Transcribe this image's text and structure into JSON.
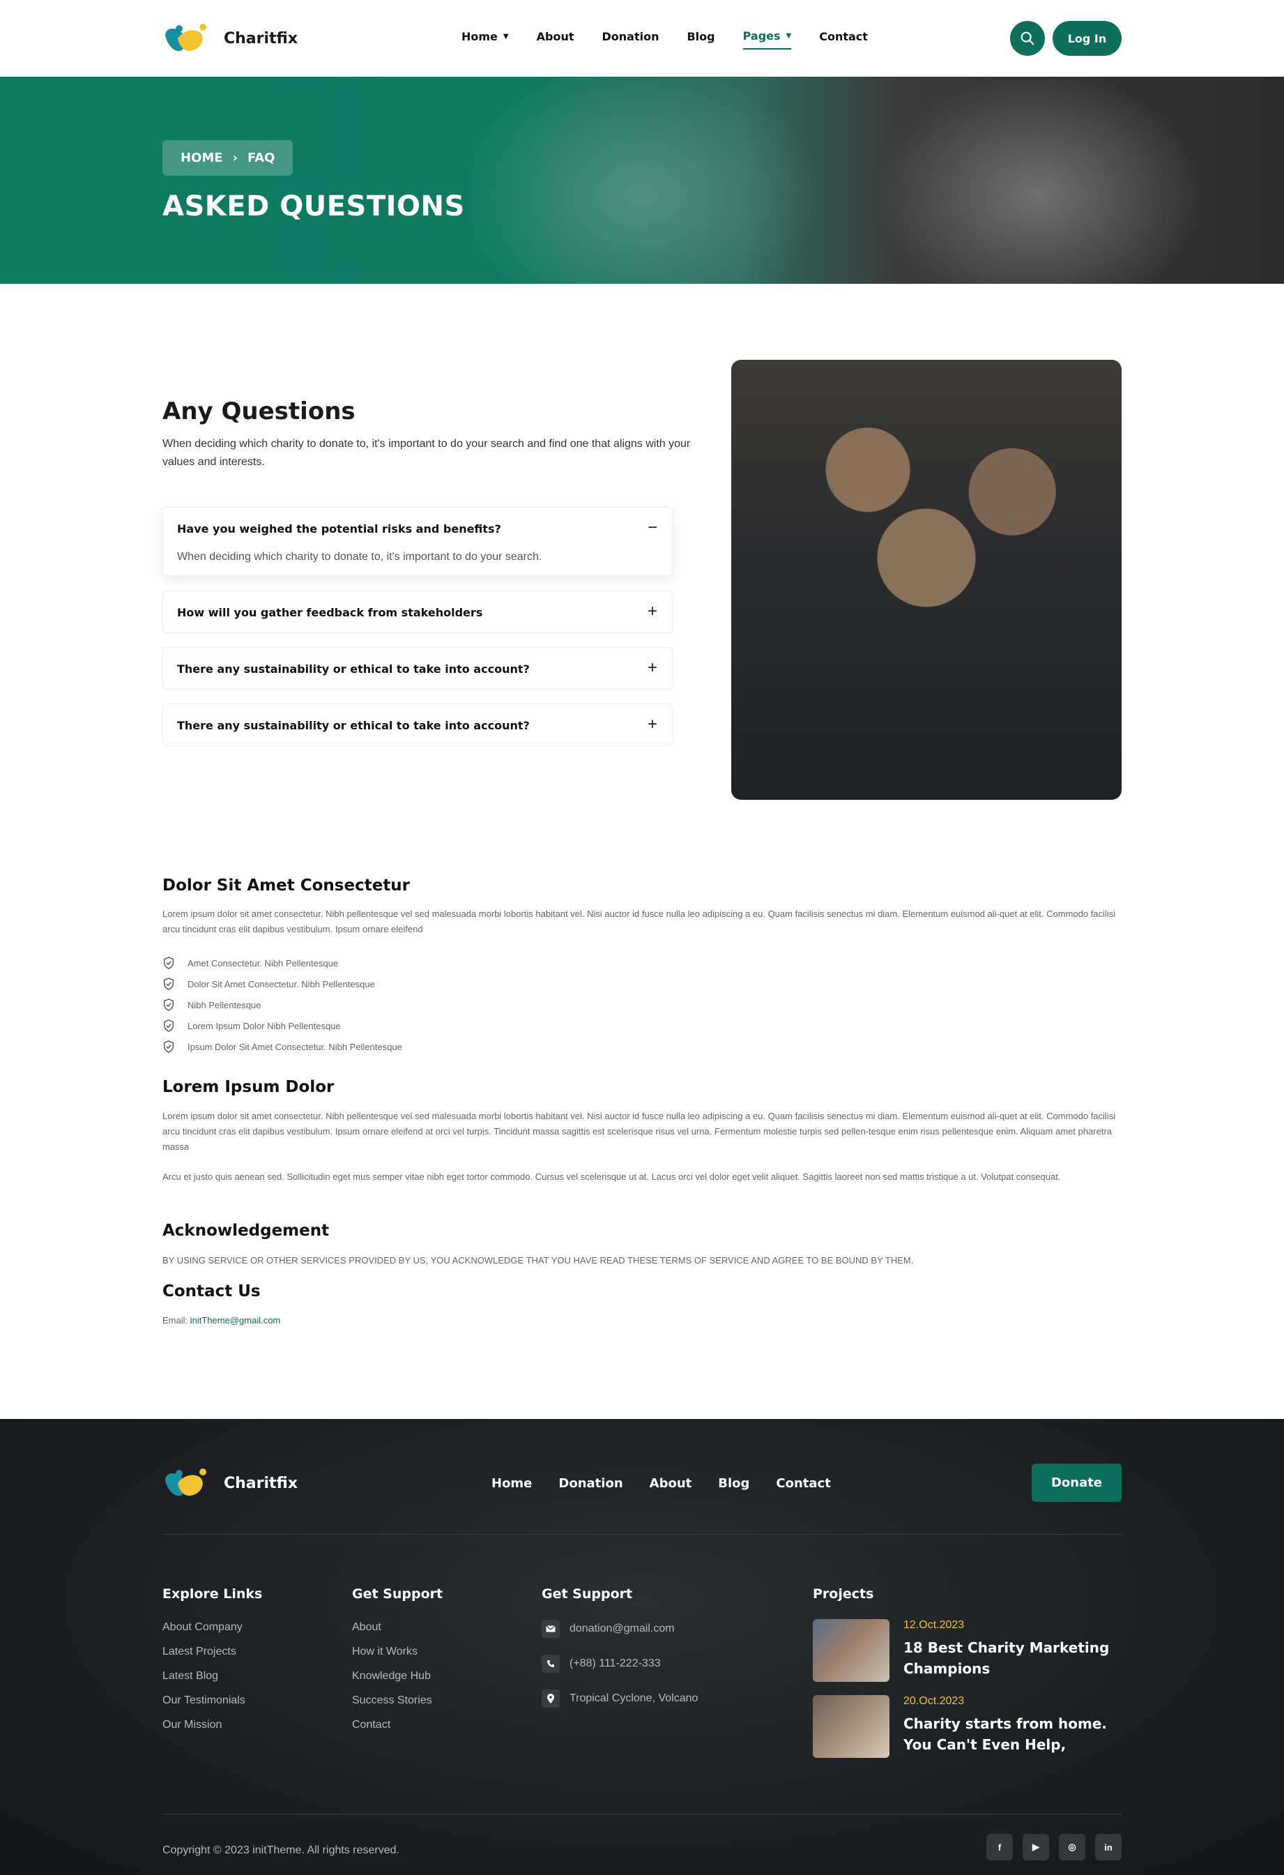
{
  "brand": {
    "name": "Charitfix",
    "accent": "#0d6e5b",
    "logo_teal": "#1a8fa3",
    "logo_yellow": "#f2c230"
  },
  "nav": {
    "items": [
      {
        "label": "Home",
        "dropdown": true
      },
      {
        "label": "About"
      },
      {
        "label": "Donation"
      },
      {
        "label": "Blog"
      },
      {
        "label": "Pages",
        "dropdown": true,
        "active": true
      },
      {
        "label": "Contact"
      }
    ],
    "search_icon": "search-icon",
    "login_label": "Log In"
  },
  "hero": {
    "breadcrumb_home": "HOME",
    "breadcrumb_sep": "›",
    "breadcrumb_current": "FAQ",
    "title": "ASKED QUESTIONS"
  },
  "faq": {
    "title": "Any Questions",
    "intro": "When deciding which charity to donate to, it's important to do your search and find one that aligns with your values and interests.",
    "items": [
      {
        "question": "Have you weighed the potential risks and benefits?",
        "answer": "When deciding which charity to donate to, it's important to do your search.",
        "open": true,
        "toggle": "−"
      },
      {
        "question": "How will you gather feedback from stakeholders",
        "open": false,
        "toggle": "+"
      },
      {
        "question": "There any sustainability or ethical to take into account?",
        "open": false,
        "toggle": "+"
      },
      {
        "question": "There any sustainability or ethical to take into account?",
        "open": false,
        "toggle": "+"
      }
    ]
  },
  "content": {
    "section1_title": "Dolor Sit Amet Consectetur",
    "section1_text": "Lorem ipsum dolor sit amet consectetur. Nibh pellentesque vel sed malesuada morbi lobortis habitant vel. Nisi auctor id fusce nulla leo adipiscing a eu. Quam facilisis senectus mi diam. Elementum euismod ali-quet at elit. Commodo facilisi arcu tincidunt cras elit dapibus vestibulum. Ipsum ornare eleifend",
    "checklist": [
      "Amet Consectetur. Nibh Pellentesque",
      "Dolor Sit Amet Consectetur. Nibh Pellentesque",
      "Nibh Pellentesque",
      "Lorem Ipsum Dolor Nibh Pellentesque",
      "Ipsum Dolor Sit Amet Consectetur. Nibh Pellentesque"
    ],
    "section2_title": "Lorem Ipsum Dolor",
    "section2_text1": "Lorem ipsum dolor sit amet consectetur. Nibh pellentesque vel sed malesuada morbi lobortis habitant vel. Nisi auctor id fusce nulla leo adipiscing a eu. Quam facilisis senectus mi diam. Elementum euismod ali-quet at elit. Commodo facilisi arcu tincidunt cras elit dapibus vestibulum. Ipsum ornare eleifend at orci vel turpis. Tincidunt massa sagittis est scelerisque risus vel urna. Fermentum molestie turpis sed pellen-tesque enim risus pellentesque enim. Aliquam amet pharetra massa",
    "section2_text2": "Arcu et justo quis aenean sed. Sollicitudin eget mus semper vitae nibh eget tortor commodo. Cursus vel scelerisque ut at. Lacus orci vel dolor eget velit aliquet. Sagittis laoreet non sed mattis tristique a ut. Volutpat consequat.",
    "section3_title": "Acknowledgement",
    "section3_text": "BY USING SERVICE OR OTHER SERVICES PROVIDED BY US, YOU ACKNOWLEDGE THAT YOU HAVE READ THESE TERMS OF SERVICE AND AGREE TO BE BOUND BY THEM.",
    "section4_title": "Contact Us",
    "email_label": "Email:",
    "email_value": "initTheme@gmail.com"
  },
  "footer": {
    "nav": [
      "Home",
      "Donation",
      "About",
      "Blog",
      "Contact"
    ],
    "donate_label": "Donate",
    "explore": {
      "title": "Explore Links",
      "links": [
        "About Company",
        "Latest Projects",
        "Latest Blog",
        "Our Testimonials",
        "Our Mission"
      ]
    },
    "support": {
      "title": "Get Support",
      "links": [
        "About",
        "How it Works",
        "Knowledge Hub",
        "Success Stories",
        "Contact"
      ]
    },
    "contact": {
      "title": "Get Support",
      "email": "donation@gmail.com",
      "phone": "(+88) 111-222-333",
      "address": "Tropical Cyclone, Volcano"
    },
    "projects": {
      "title": "Projects",
      "items": [
        {
          "date": "12.Oct.2023",
          "title": "18 Best Charity Marketing Champions"
        },
        {
          "date": "20.Oct.2023",
          "title": "Charity starts from home. You Can't Even Help,"
        }
      ]
    },
    "copyright": "Copyright © 2023 initTheme. All rights reserved.",
    "social": [
      {
        "icon": "facebook-icon",
        "glyph": "f"
      },
      {
        "icon": "youtube-icon",
        "glyph": "▶"
      },
      {
        "icon": "instagram-icon",
        "glyph": "◎"
      },
      {
        "icon": "linkedin-icon",
        "glyph": "in"
      }
    ]
  }
}
